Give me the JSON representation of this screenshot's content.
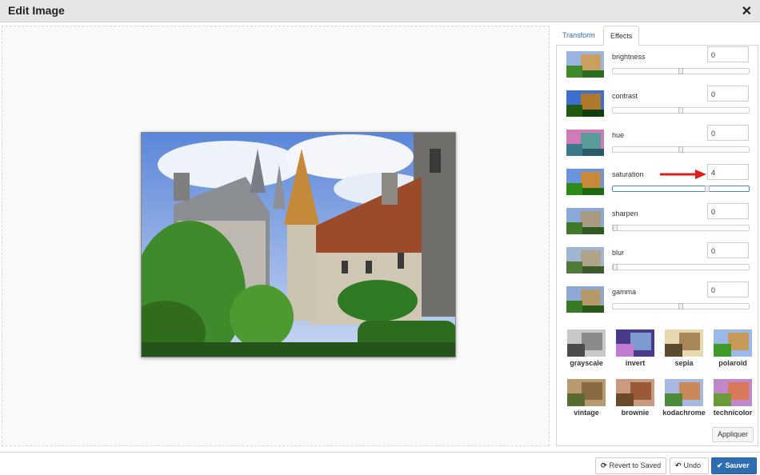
{
  "window": {
    "title": "Edit Image",
    "close_icon": "close-icon"
  },
  "tabs": [
    {
      "label": "Transform",
      "active": false
    },
    {
      "label": "Effects",
      "active": true
    }
  ],
  "effects": [
    {
      "label": "brightness",
      "value": "0",
      "slider_fraction": 0.5
    },
    {
      "label": "contrast",
      "value": "0",
      "slider_fraction": 0.5
    },
    {
      "label": "hue",
      "value": "0",
      "slider_fraction": 0.5
    },
    {
      "label": "saturation",
      "value": "4",
      "slider_fraction": 0.7
    },
    {
      "label": "sharpen",
      "value": "0",
      "slider_fraction": 0.0
    },
    {
      "label": "blur",
      "value": "0",
      "slider_fraction": 0.0
    },
    {
      "label": "gamma",
      "value": "0",
      "slider_fraction": 0.5
    }
  ],
  "filters": [
    {
      "label": "grayscale"
    },
    {
      "label": "invert"
    },
    {
      "label": "sepia"
    },
    {
      "label": "polaroid"
    },
    {
      "label": "vintage"
    },
    {
      "label": "brownie"
    },
    {
      "label": "kodachrome"
    },
    {
      "label": "technicolor"
    }
  ],
  "apply_label": "Appliquer",
  "footer": {
    "revert_label": "Revert to Saved",
    "undo_label": "Undo",
    "save_label": "Sauver"
  },
  "colors": {
    "accent": "#2e6db4",
    "link": "#2a6ab3",
    "arrow": "#e11d1d"
  }
}
